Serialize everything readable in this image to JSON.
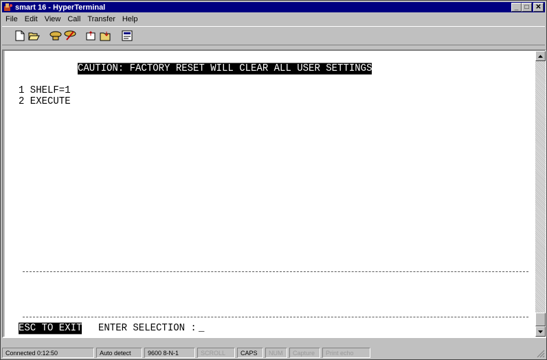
{
  "window": {
    "title": "smart 16 - HyperTerminal",
    "buttons": {
      "minimize": "_",
      "maximize": "□",
      "close": "✕"
    }
  },
  "menu": [
    {
      "label": "File",
      "accel": "F"
    },
    {
      "label": "Edit",
      "accel": "E"
    },
    {
      "label": "View",
      "accel": "V"
    },
    {
      "label": "Call",
      "accel": "C"
    },
    {
      "label": "Transfer",
      "accel": "T"
    },
    {
      "label": "Help",
      "accel": "H"
    }
  ],
  "toolbar": {
    "icons": [
      "new-icon",
      "open-icon",
      "connect-icon",
      "disconnect-icon",
      "send-icon",
      "receive-icon",
      "properties-icon"
    ]
  },
  "terminal": {
    "caution": "CAUTION: FACTORY RESET WILL CLEAR ALL USER SETTINGS",
    "options": [
      "1 SHELF=1",
      "2 EXECUTE"
    ],
    "esc_label": "ESC TO EXIT",
    "prompt": "ENTER SELECTION :",
    "cursor": "_"
  },
  "status": {
    "connected": "Connected 0:12:50",
    "detect": "Auto detect",
    "port": "9600 8-N-1",
    "scroll": "SCROLL",
    "caps": "CAPS",
    "num": "NUM",
    "capture": "Capture",
    "print_echo": "Print echo"
  },
  "colors": {
    "title_bar": "#000080",
    "chrome": "#c0c0c0",
    "terminal_bg": "#ffffff",
    "terminal_fg": "#000000"
  }
}
